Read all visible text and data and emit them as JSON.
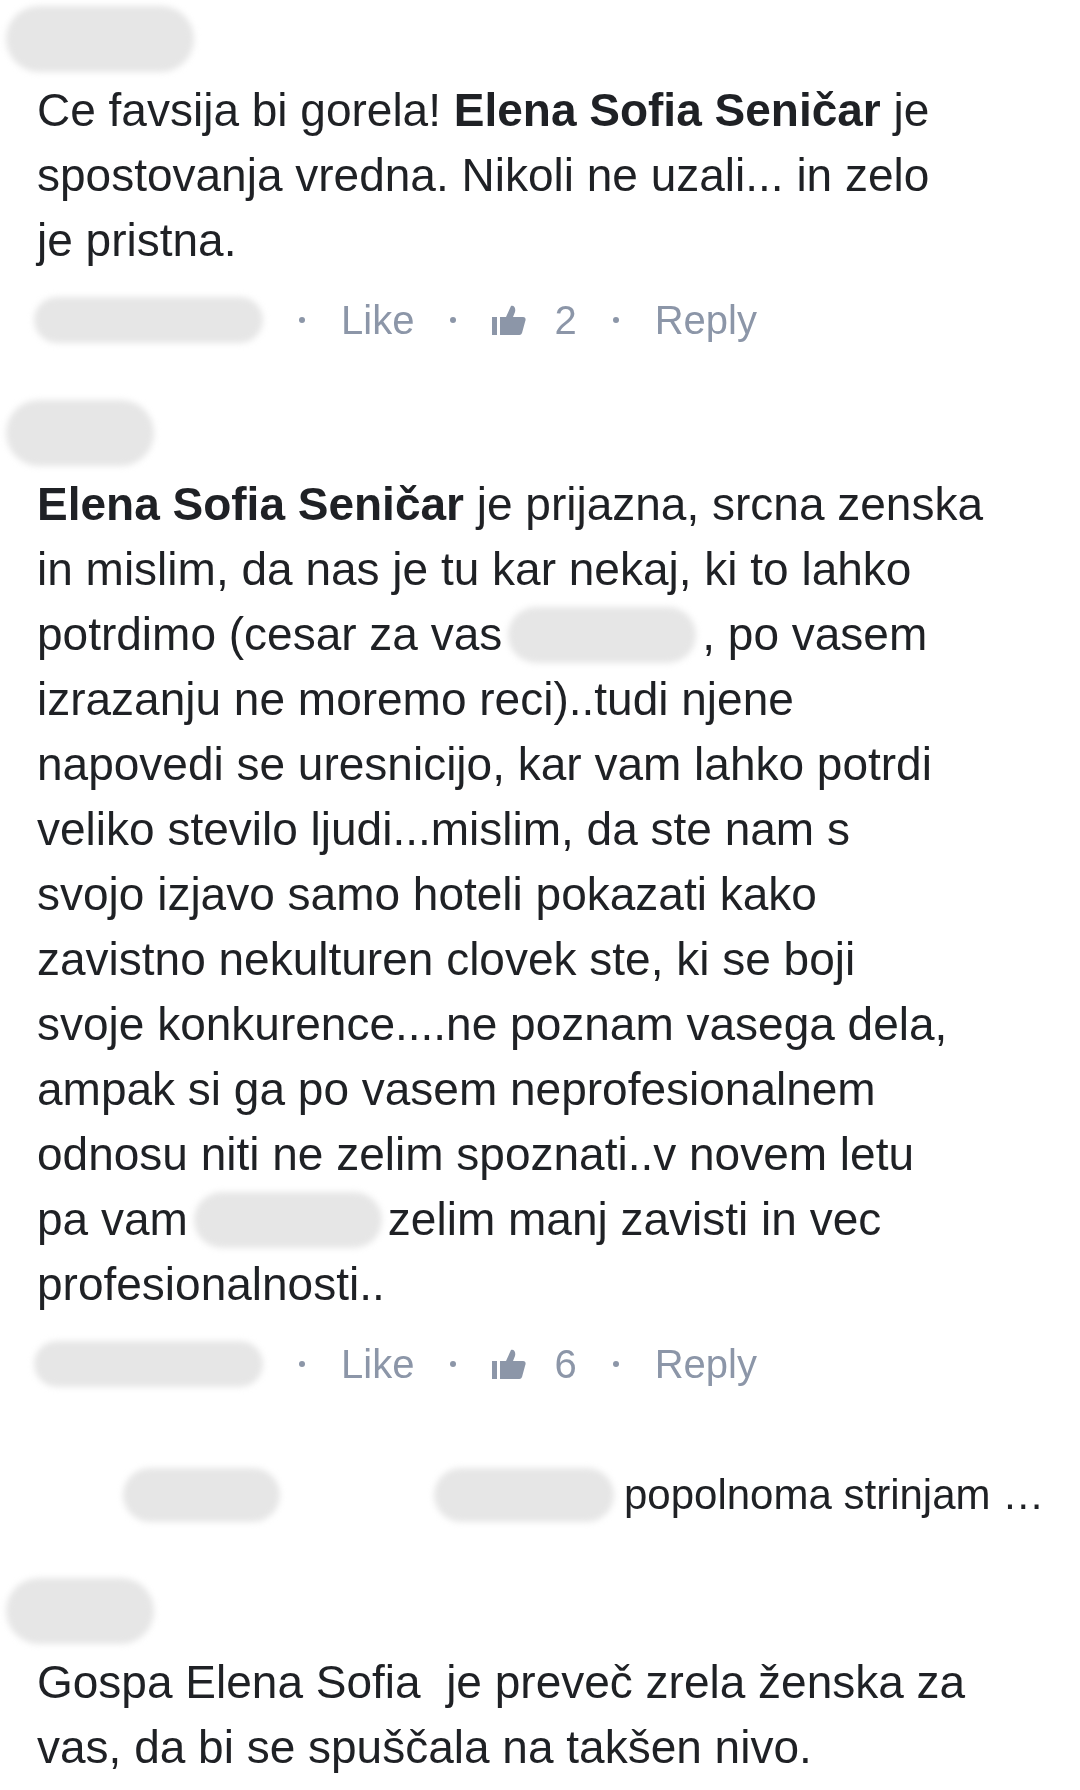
{
  "comments": [
    {
      "kind": "comment",
      "lines": [
        [
          {
            "kind": "text",
            "text": "Ce favsija bi gorela! **Elena Sofia Seničar** je"
          }
        ],
        [
          {
            "kind": "text",
            "text": "spostovanja vredna. Nikoli ne uzali... in zelo"
          }
        ],
        [
          {
            "kind": "text",
            "text": "je pristna."
          }
        ]
      ],
      "actions": {
        "like": "Like",
        "like_count": "2",
        "reply": "Reply"
      }
    },
    {
      "kind": "comment",
      "lines": [
        [
          {
            "kind": "text",
            "text": "**Elena Sofia Seničar** je prijazna, srcna zenska"
          }
        ],
        [
          {
            "kind": "text",
            "text": "in mislim, da nas je tu kar nekaj, ki to lahko"
          }
        ],
        [
          {
            "kind": "text",
            "text": "potrdimo (cesar za vas"
          },
          {
            "kind": "blur"
          },
          {
            "kind": "text",
            "text": ", po vasem"
          }
        ],
        [
          {
            "kind": "text",
            "text": "izrazanju ne moremo reci)..tudi njene"
          }
        ],
        [
          {
            "kind": "text",
            "text": "napovedi se uresnicijo, kar vam lahko potrdi"
          }
        ],
        [
          {
            "kind": "text",
            "text": "veliko stevilo ljudi...mislim, da ste nam s"
          }
        ],
        [
          {
            "kind": "text",
            "text": "svojo izjavo samo hoteli pokazati kako"
          }
        ],
        [
          {
            "kind": "text",
            "text": "zavistno nekulturen clovek ste, ki se boji"
          }
        ],
        [
          {
            "kind": "text",
            "text": "svoje konkurence....ne poznam vasega dela,"
          }
        ],
        [
          {
            "kind": "text",
            "text": "ampak si ga po vasem neprofesionalnem"
          }
        ],
        [
          {
            "kind": "text",
            "text": "odnosu niti ne zelim spoznati..v novem letu"
          }
        ],
        [
          {
            "kind": "text",
            "text": "pa vam"
          },
          {
            "kind": "blur"
          },
          {
            "kind": "text",
            "text": "zelim manj zavisti in vec"
          }
        ],
        [
          {
            "kind": "text",
            "text": "profesionalnosti.."
          }
        ]
      ],
      "actions": {
        "like": "Like",
        "like_count": "6",
        "reply": "Reply"
      }
    },
    {
      "kind": "reply_summary",
      "text": "popolnoma strinjam …"
    },
    {
      "kind": "comment",
      "lines": [
        [
          {
            "kind": "text",
            "text": "Gospa Elena Sofia  je preveč zrela ženska za"
          }
        ],
        [
          {
            "kind": "text",
            "text": "vas, da bi se spuščala na takšen nivo."
          }
        ]
      ]
    }
  ]
}
